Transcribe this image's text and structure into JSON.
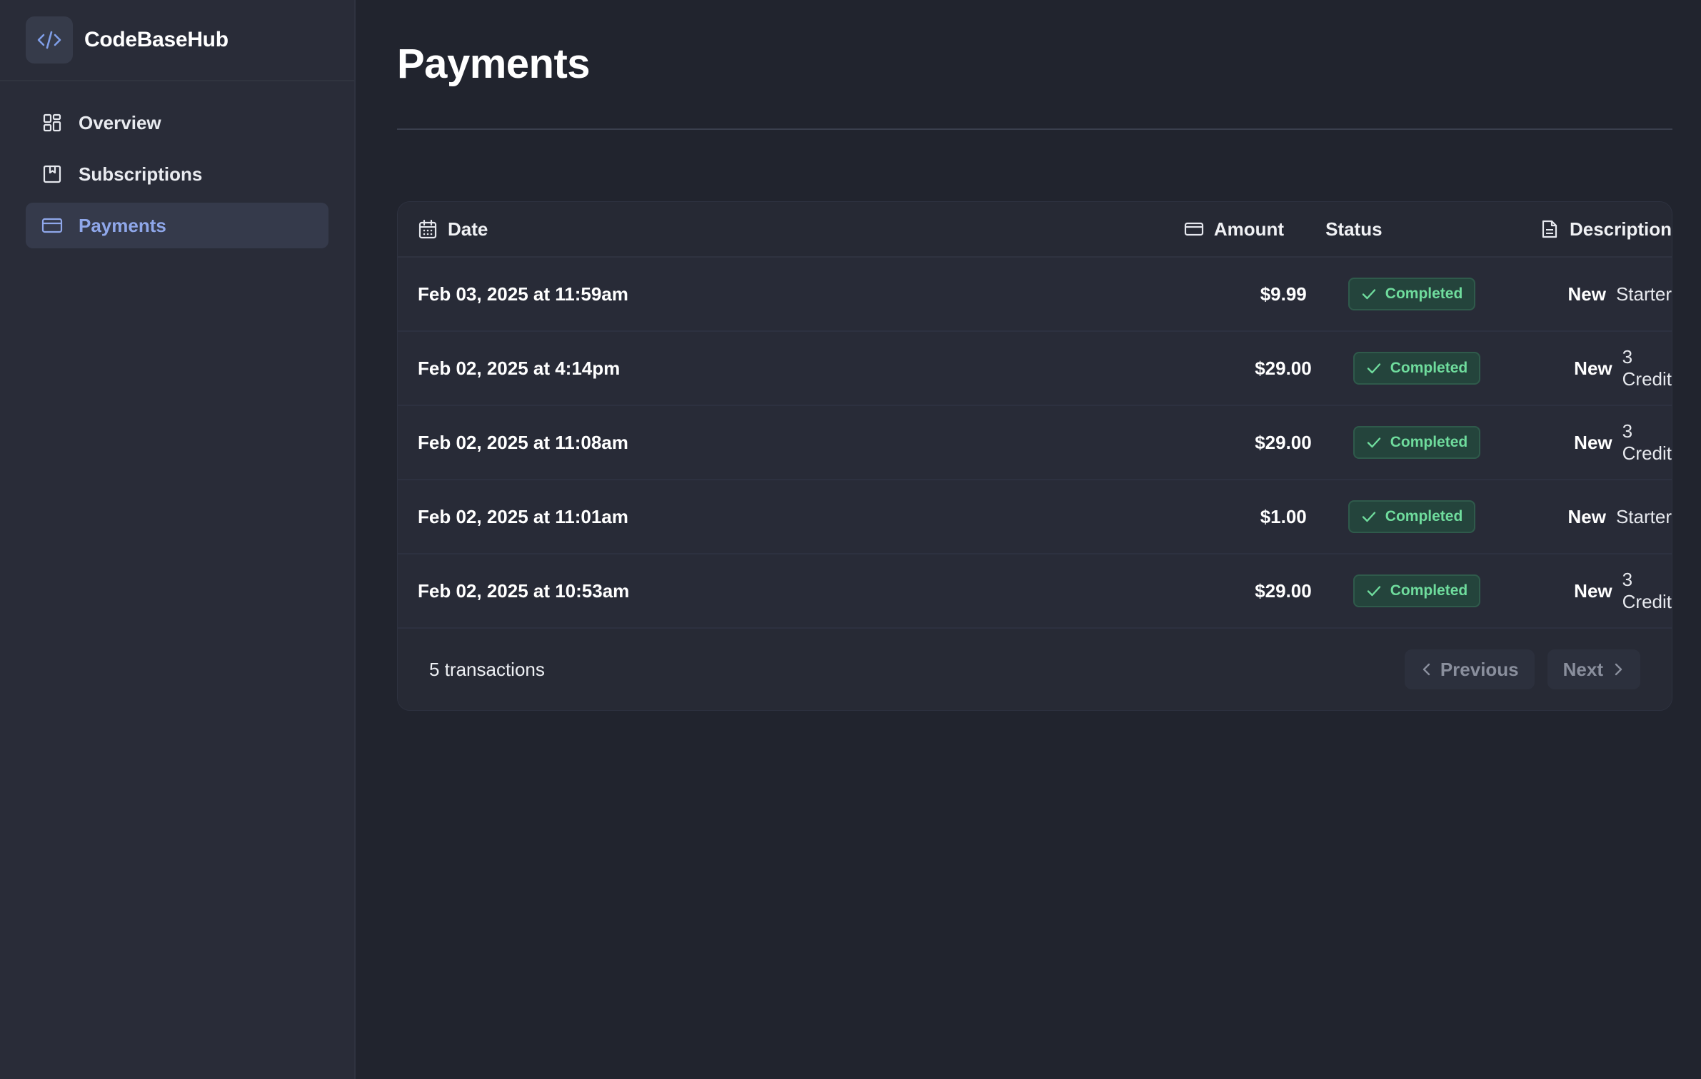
{
  "app": {
    "name": "CodeBaseHub",
    "logo_icon": "code-icon",
    "accent_color": "#8fa7ea"
  },
  "sidebar": {
    "items": [
      {
        "label": "Overview",
        "icon": "dashboard-grid-icon",
        "active": false
      },
      {
        "label": "Subscriptions",
        "icon": "bookmark-icon",
        "active": false
      },
      {
        "label": "Payments",
        "icon": "credit-card-icon",
        "active": true
      }
    ]
  },
  "page": {
    "title": "Payments"
  },
  "table": {
    "headers": {
      "date": "Date",
      "amount": "Amount",
      "status": "Status",
      "description": "Description"
    },
    "rows": [
      {
        "date": "Feb 03, 2025 at 11:59am",
        "amount": "$9.99",
        "status": "Completed",
        "desc_type": "New",
        "desc_plan": "Starter"
      },
      {
        "date": "Feb 02, 2025 at 4:14pm",
        "amount": "$29.00",
        "status": "Completed",
        "desc_type": "New",
        "desc_plan": "3 Credit"
      },
      {
        "date": "Feb 02, 2025 at 11:08am",
        "amount": "$29.00",
        "status": "Completed",
        "desc_type": "New",
        "desc_plan": "3 Credit"
      },
      {
        "date": "Feb 02, 2025 at 11:01am",
        "amount": "$1.00",
        "status": "Completed",
        "desc_type": "New",
        "desc_plan": "Starter"
      },
      {
        "date": "Feb 02, 2025 at 10:53am",
        "amount": "$29.00",
        "status": "Completed",
        "desc_type": "New",
        "desc_plan": "3 Credit"
      }
    ],
    "status_color": "#6fdc9d"
  },
  "footer": {
    "count": "5 transactions",
    "prev_label": "Previous",
    "next_label": "Next"
  }
}
